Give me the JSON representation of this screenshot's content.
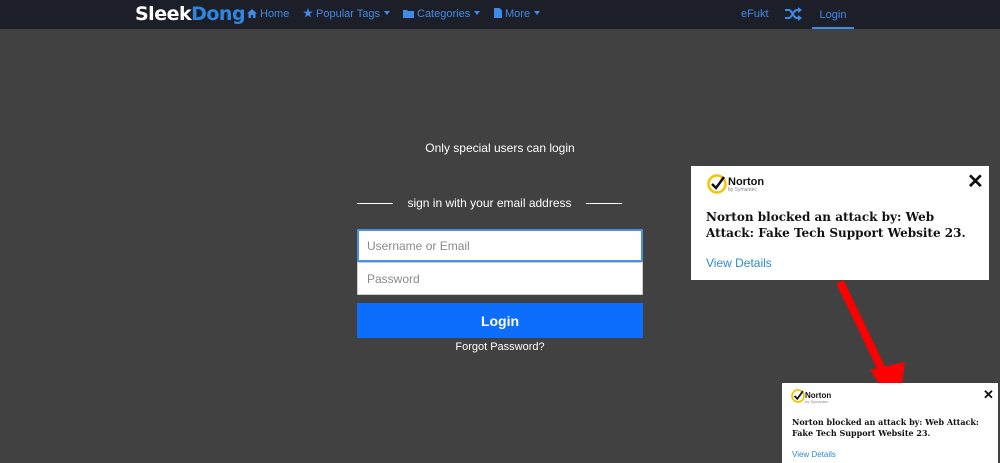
{
  "navbar": {
    "logo_main": "Sleek",
    "logo_accent": "Dong",
    "home_label": "Home",
    "popular_tags_label": "Popular Tags",
    "categories_label": "Categories",
    "more_label": "More",
    "efukt_label": "eFukt",
    "login_label": "Login",
    "icons": [
      "home-icon",
      "star-icon",
      "folder-icon",
      "file-icon",
      "shuffle-icon"
    ]
  },
  "login": {
    "tagline": "Only special users can login",
    "signin_text": "sign in with your email address",
    "username_placeholder": "Username or Email",
    "password_placeholder": "Password",
    "button_label": "Login",
    "forgot_label": "Forgot Password?"
  },
  "norton_popup": {
    "brand": "Norton",
    "brand_sub": "by Symantec",
    "message": "Norton blocked an attack by: Web Attack: Fake Tech Support Website 23.",
    "details_label": "View Details",
    "close_glyph": "✕"
  },
  "norton_popup_small": {
    "brand": "Norton",
    "brand_sub": "by Symantec",
    "message": "Norton blocked an attack by: Web Attack: Fake Tech Support Website 23.",
    "details_label": "View Details",
    "close_glyph": "✕"
  },
  "colors": {
    "navbar_bg": "#1c1f28",
    "page_bg": "#414141",
    "accent": "#3f8be8",
    "login_button": "#0d6efd",
    "norton_check": "#f5c400",
    "arrow": "#ff0000"
  }
}
